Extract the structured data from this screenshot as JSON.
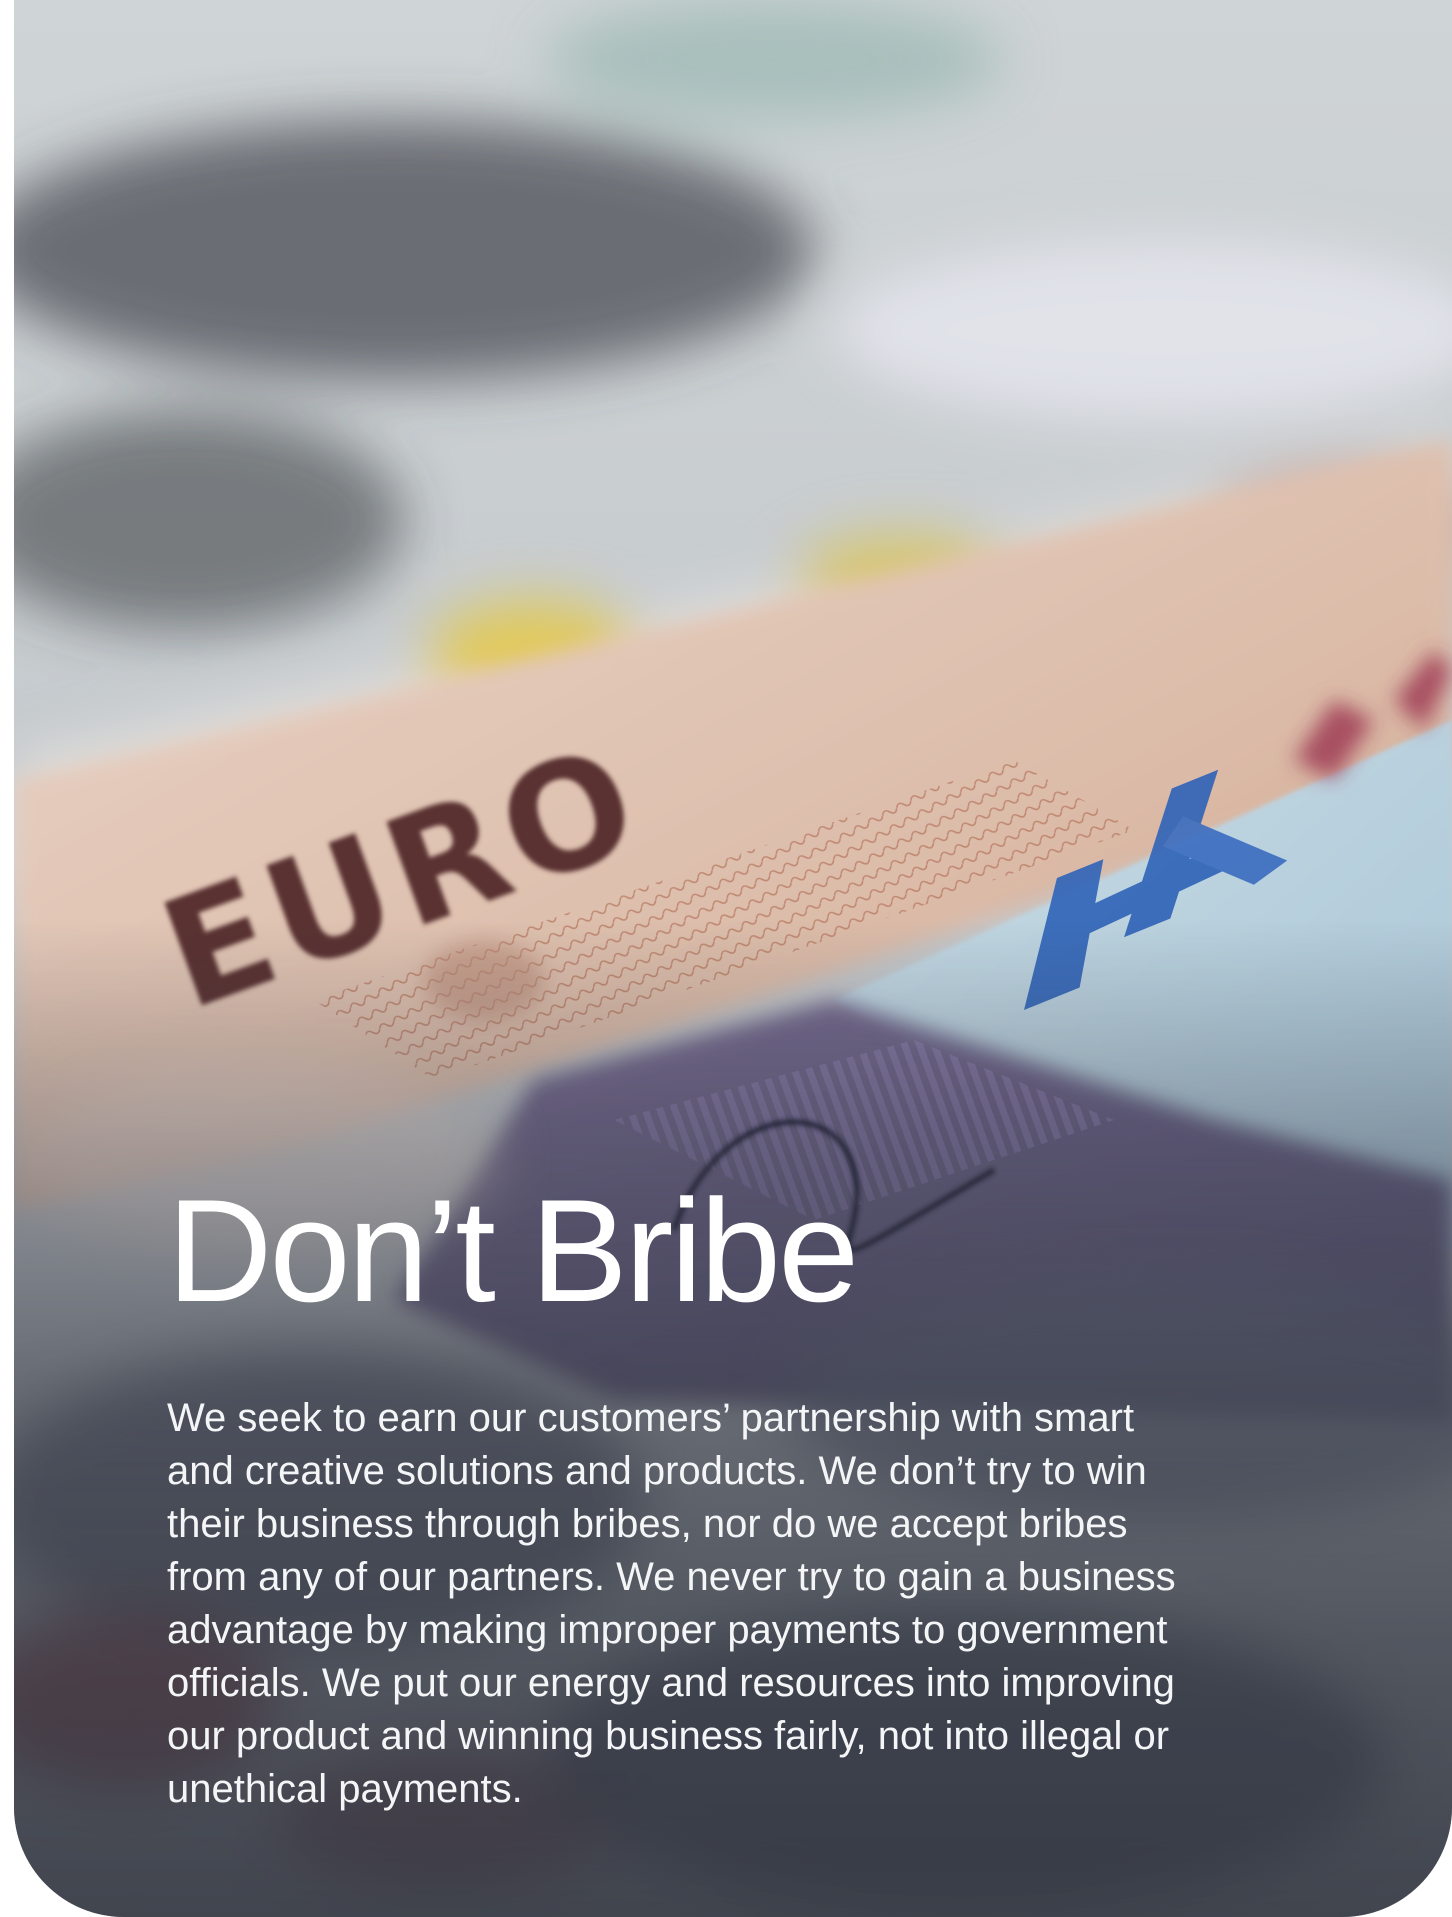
{
  "page": {
    "title": "Don’t Bribe",
    "body": "We seek to earn our customers’ partnership with smart and creative solutions and products. We don’t try to win their business through bribes, nor do we accept bribes from any of our partners. We never try to gain a business advantage by making improper payments to government officials. We put our energy and resources into improving our product and winning business fairly, not into illegal or unethical payments."
  },
  "image": {
    "subject": "banknotes-photo",
    "banknote_text": "EURO"
  },
  "colors": {
    "title_text": "#ffffff",
    "body_text": "#f4f5f7",
    "overlay": "#343842"
  }
}
